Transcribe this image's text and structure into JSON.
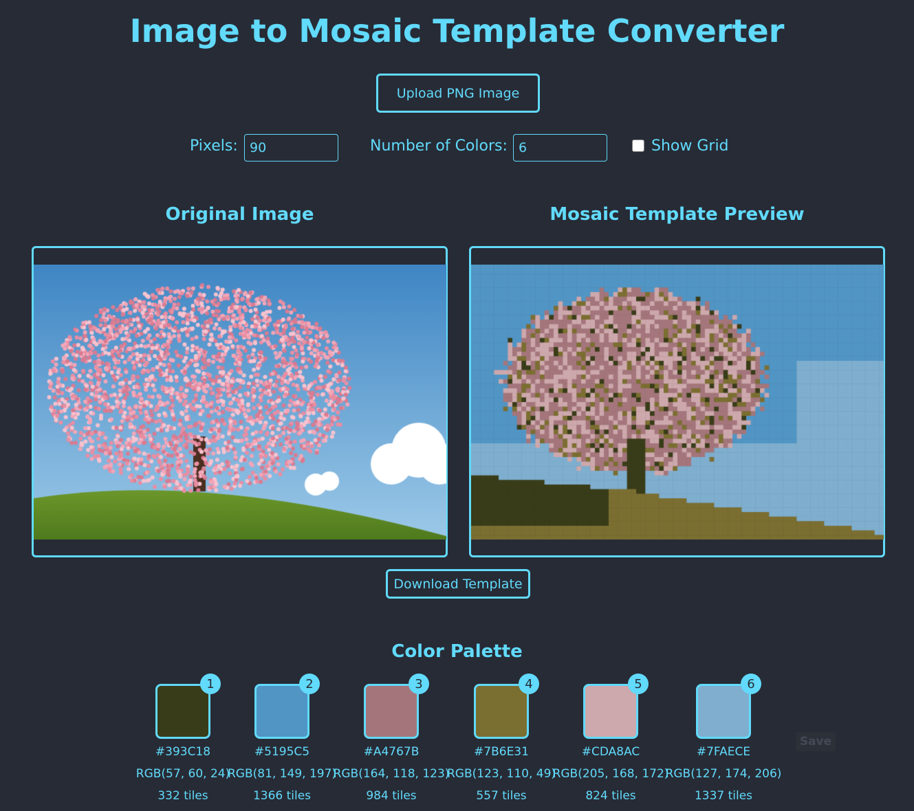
{
  "title": "Image to Mosaic Template Converter",
  "upload_label": "Upload PNG Image",
  "controls": {
    "pixels_label": "Pixels:",
    "pixels_value": "90",
    "colors_label": "Number of Colors:",
    "colors_value": "6",
    "grid_label": "Show Grid",
    "grid_checked": false
  },
  "original_heading": "Original Image",
  "preview_heading": "Mosaic Template Preview",
  "download_label": "Download Template",
  "palette_heading": "Color Palette",
  "palette": [
    {
      "n": "1",
      "hex": "#393C18",
      "rgb": "RGB(57, 60, 24)",
      "tiles": "332 tiles"
    },
    {
      "n": "2",
      "hex": "#5195C5",
      "rgb": "RGB(81, 149, 197)",
      "tiles": "1366 tiles"
    },
    {
      "n": "3",
      "hex": "#A4767B",
      "rgb": "RGB(164, 118, 123)",
      "tiles": "984 tiles"
    },
    {
      "n": "4",
      "hex": "#7B6E31",
      "rgb": "RGB(123, 110, 49)",
      "tiles": "557 tiles"
    },
    {
      "n": "5",
      "hex": "#CDA8AC",
      "rgb": "RGB(205, 168, 172)",
      "tiles": "824 tiles"
    },
    {
      "n": "6",
      "hex": "#7FAECE",
      "rgb": "RGB(127, 174, 206)",
      "tiles": "1337 tiles"
    }
  ],
  "save_label": "Save",
  "accent": "#61dafb"
}
